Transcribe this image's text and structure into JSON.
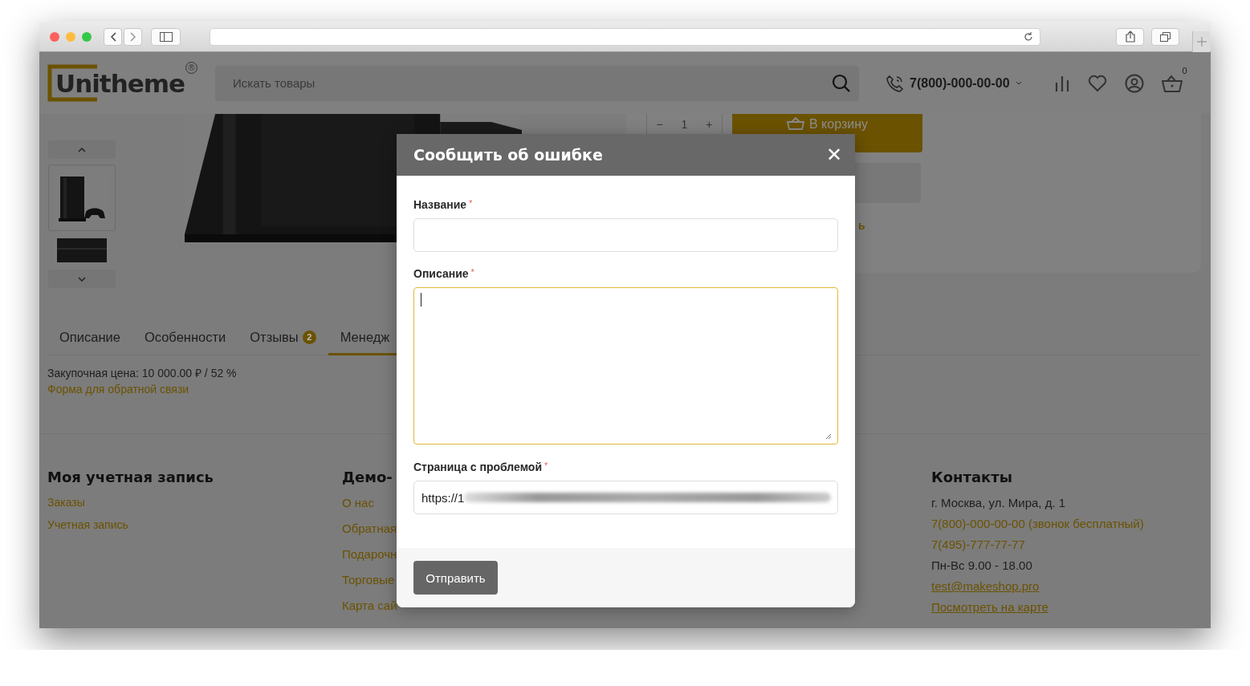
{
  "header": {
    "logo": "Unitheme",
    "logo_mark": "®",
    "search": {
      "placeholder": "Искать товары"
    },
    "phone": "7(800)-000-00-00",
    "cart_count": "0"
  },
  "gallery": {
    "thumbnails": [
      {
        "selected": true
      },
      {
        "selected": false
      }
    ]
  },
  "buy_panel": {
    "minus": "−",
    "quantity": "1",
    "plus": "+",
    "cart_button": "В корзину",
    "link_fragment": "ь"
  },
  "tabs": [
    {
      "label": "Описание",
      "selected": false
    },
    {
      "label": "Особенности",
      "selected": false
    },
    {
      "label": "Отзывы",
      "badge": "2",
      "selected": false
    },
    {
      "label": "Менедж",
      "selected": true
    }
  ],
  "manager_info": {
    "purchase_price": "Закупочная цена: 10 000.00 ₽ / 52 %",
    "feedback_link": "Форма для обратной связи"
  },
  "footer": {
    "columns": [
      {
        "title": "Моя учетная запись",
        "items": [
          {
            "text": "Заказы",
            "kind": "link"
          },
          {
            "text": "Учетная запись",
            "kind": "link"
          }
        ]
      },
      {
        "title": "Демо-",
        "items": [
          {
            "text": "О нас",
            "kind": "link"
          },
          {
            "text": "Обратная",
            "kind": "link"
          },
          {
            "text": "Подарочн",
            "kind": "link"
          },
          {
            "text": "Торговые",
            "kind": "link"
          },
          {
            "text": "Карта сай",
            "kind": "link"
          }
        ]
      },
      {
        "title": "Контакты",
        "items": [
          {
            "text": "г. Москва, ул. Мира, д. 1",
            "kind": "text"
          },
          {
            "text": "7(800)-000-00-00 (звонок бесплатный)",
            "kind": "link"
          },
          {
            "text": "7(495)-777-77-77",
            "kind": "link"
          },
          {
            "text": "Пн-Вс 9.00 - 18.00",
            "kind": "text"
          },
          {
            "text": "test@makeshop.pro",
            "kind": "underlined"
          },
          {
            "text": "Посмотреть на карте",
            "kind": "underlined"
          }
        ]
      }
    ]
  },
  "modal": {
    "title": "Сообщить об ошибке",
    "close": "✕",
    "fields": [
      {
        "label": "Название",
        "required_mark": "*",
        "kind": "input",
        "focused": false
      },
      {
        "label": "Описание",
        "required_mark": "*",
        "kind": "textarea",
        "focused": true
      },
      {
        "label": "Страница с проблемой",
        "required_mark": "*",
        "kind": "input",
        "focused": false,
        "value": "https://1",
        "redacted": true
      }
    ],
    "submit": "Отправить"
  }
}
